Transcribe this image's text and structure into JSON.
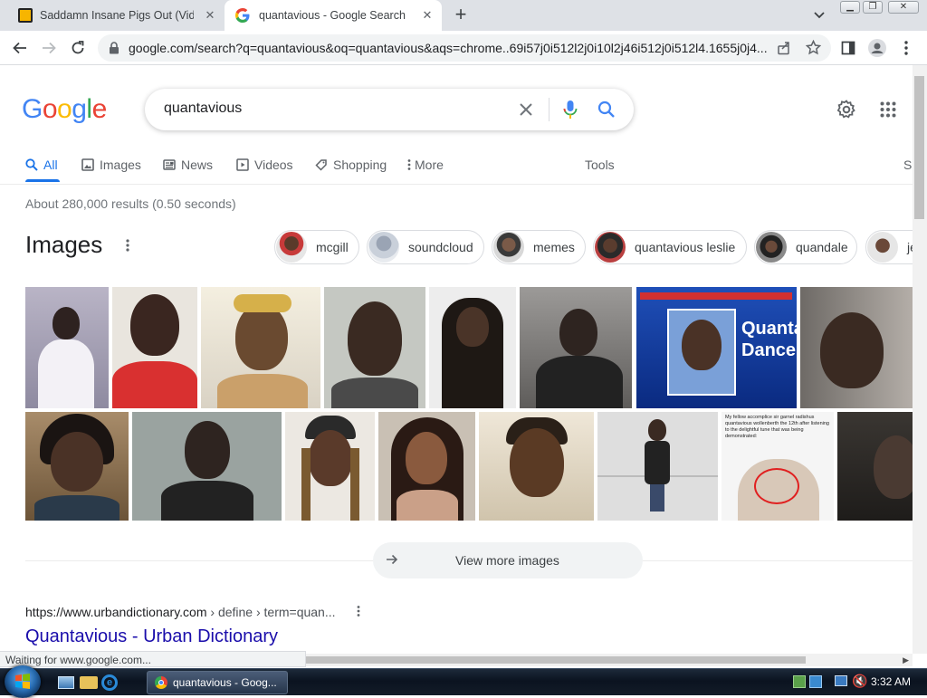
{
  "browser": {
    "tabs": [
      {
        "title": "Saddamn Insane Pigs Out (Video",
        "active": false
      },
      {
        "title": "quantavious - Google Search",
        "active": true
      }
    ],
    "url": "google.com/search?q=quantavious&oq=quantavious&aqs=chrome..69i57j0i512l2j0i10l2j46i512j0i512l4.1655j0j4..."
  },
  "google": {
    "logo": "Google",
    "query": "quantavious",
    "nav_tabs": [
      {
        "label": "All",
        "icon": "search-icon",
        "active": true
      },
      {
        "label": "Images",
        "icon": "image-icon"
      },
      {
        "label": "News",
        "icon": "news-icon"
      },
      {
        "label": "Videos",
        "icon": "video-icon"
      },
      {
        "label": "Shopping",
        "icon": "tag-icon"
      },
      {
        "label": "More",
        "icon": "more-vertical-icon"
      }
    ],
    "tools_label": "Tools",
    "safesearch_partial": "S",
    "result_stats": "About 280,000 results (0.50 seconds)",
    "images_heading": "Images",
    "chips": [
      "mcgill",
      "soundcloud",
      "memes",
      "quantavious leslie",
      "quandale",
      "je"
    ],
    "image_text_overlays": {
      "news_graphic_line1": "Quanta",
      "news_graphic_line2": "Dance",
      "meme_caption": "My fellow accomplice sir garnel radishus quantavious wollenberth the 12th after listening to the delightful tune that was being demonstrated:"
    },
    "view_more_label": "View more images",
    "result": {
      "url_domain": "https://www.urbandictionary.com",
      "url_path": " › define › term=quan...",
      "title": "Quantavious - Urban Dictionary"
    }
  },
  "status_bar": "Waiting for www.google.com...",
  "taskbar": {
    "window_label": "quantavious - Goog...",
    "clock": "3:32 AM"
  },
  "colors": {
    "google_blue": "#4285f4",
    "google_red": "#ea4335",
    "google_yellow": "#fbbc05",
    "google_green": "#34a853",
    "link": "#1a0dab",
    "active_tab": "#1a73e8"
  }
}
